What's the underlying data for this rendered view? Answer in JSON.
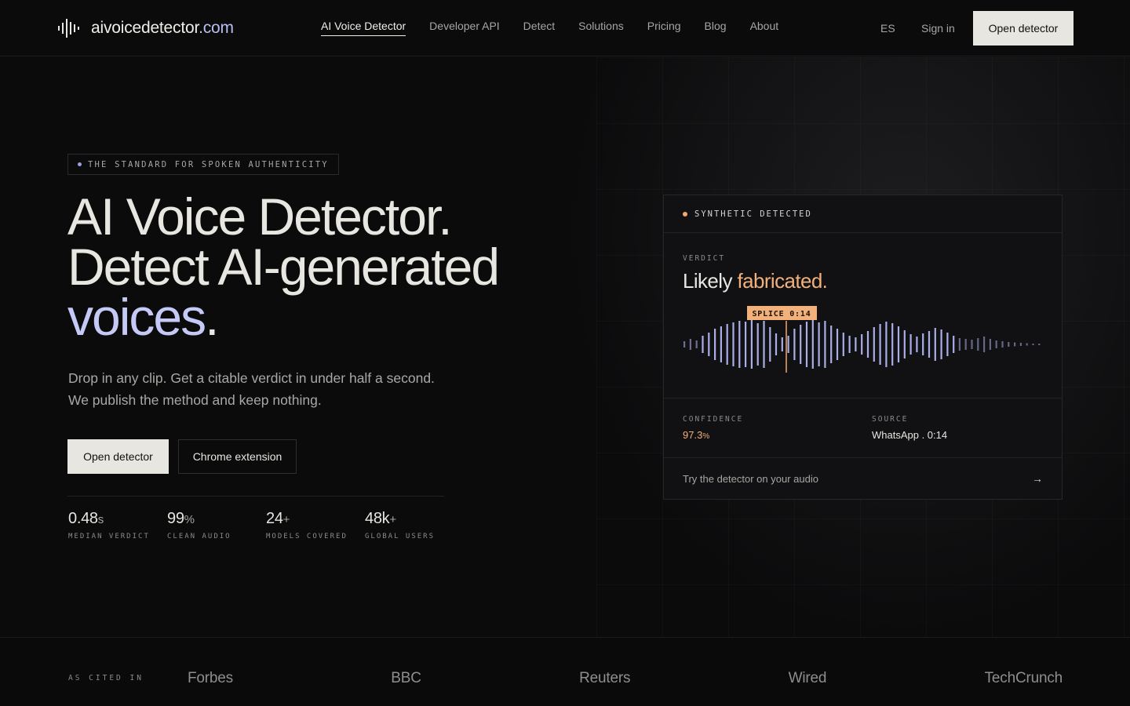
{
  "brand": {
    "name_main": "aivoicedetector",
    "name_tld": ".com",
    "logo_icon": "waveform-icon"
  },
  "nav": {
    "items": [
      {
        "label": "AI Voice Detector",
        "active": true
      },
      {
        "label": "Developer API"
      },
      {
        "label": "Detect"
      },
      {
        "label": "Solutions"
      },
      {
        "label": "Pricing"
      },
      {
        "label": "Blog"
      },
      {
        "label": "About"
      }
    ],
    "lang": "ES",
    "signin": "Sign in",
    "cta": "Open detector"
  },
  "hero": {
    "eyebrow": "THE STANDARD FOR SPOKEN AUTHENTICITY",
    "title_line1": "AI Voice Detector.",
    "title_line2": "Detect AI-generated",
    "title_line3_accent": "voices",
    "title_line3_end": ".",
    "subtitle": "Drop in any clip. Get a citable verdict in under half a second. We publish the method and keep nothing.",
    "primary_button": "Open detector",
    "secondary_button": "Chrome extension",
    "stats": [
      {
        "value": "0.48",
        "unit": "s",
        "label": "MEDIAN VERDICT"
      },
      {
        "value": "99",
        "unit": "%",
        "label": "CLEAN AUDIO"
      },
      {
        "value": "24",
        "unit": "+",
        "label": "MODELS COVERED"
      },
      {
        "value": "48k",
        "unit": "+",
        "label": "GLOBAL USERS"
      }
    ]
  },
  "card": {
    "status": "SYNTHETIC DETECTED",
    "verdict_label": "VERDICT",
    "verdict_prefix": "Likely ",
    "verdict_highlight": "fabricated.",
    "splice_tag": "SPLICE 0:14",
    "confidence_label": "CONFIDENCE",
    "confidence_value": "97.3",
    "confidence_unit": "%",
    "source_label": "SOURCE",
    "source_value": "WhatsApp . 0:14",
    "footer_cta": "Try the detector on your audio",
    "footer_arrow": "→",
    "colors": {
      "accent": "#f2b07a",
      "wave": "#a9aee6"
    }
  },
  "cited": {
    "label": "AS CITED IN",
    "outlets": [
      "Forbes",
      "BBC",
      "Reuters",
      "Wired",
      "TechCrunch"
    ]
  }
}
